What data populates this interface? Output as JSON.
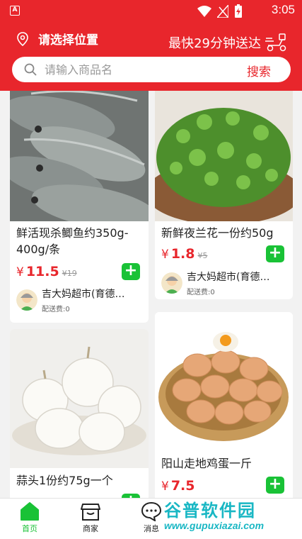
{
  "status_bar": {
    "app_badge": "A",
    "time": "3:05"
  },
  "header": {
    "location_label": "请选择位置",
    "delivery_text": "最快29分钟送达"
  },
  "search": {
    "placeholder": "请输入商品名",
    "button_label": "搜索"
  },
  "products": [
    {
      "title": "鲜活现杀鲫鱼约350g-400g/条",
      "price": "11.5",
      "original_price": "19",
      "currency": "¥",
      "shop": "吉大妈超市(育德…",
      "delivery_fee": "配送费:0"
    },
    {
      "title": "新鲜夜兰花一份约50g",
      "price": "1.8",
      "original_price": "5",
      "currency": "¥",
      "shop": "吉大妈超市(育德…",
      "delivery_fee": "配送费:0"
    },
    {
      "title": "蒜头1份约75g一个",
      "price": "",
      "original_price": "",
      "currency": "¥",
      "shop": "",
      "delivery_fee": ""
    },
    {
      "title": "阳山走地鸡蛋一斤",
      "price": "7.5",
      "original_price": "",
      "currency": "¥",
      "shop": "",
      "delivery_fee": ""
    }
  ],
  "add_button_label": "+",
  "tabs": [
    {
      "label": "首页",
      "icon": "home-icon",
      "active": true
    },
    {
      "label": "商家",
      "icon": "shop-icon",
      "active": false
    },
    {
      "label": "消息",
      "icon": "message-icon",
      "active": false
    }
  ],
  "watermark": {
    "title": "谷普软件园",
    "url": "www.gupuxiazai.com"
  },
  "colors": {
    "brand_red": "#e8262c",
    "add_green": "#19c236",
    "watermark_teal": "#19b7c4"
  }
}
